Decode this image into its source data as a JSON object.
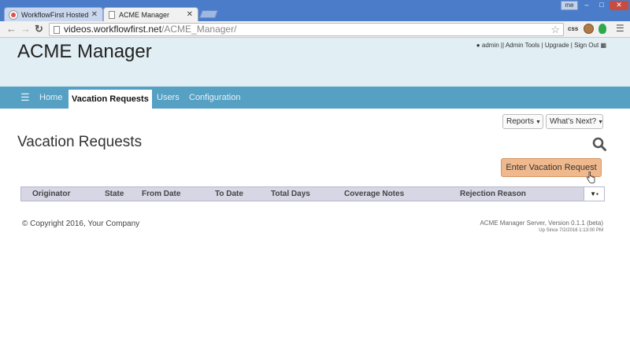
{
  "browser": {
    "tabs": [
      {
        "title": "WorkflowFirst Hosted De",
        "close": "✕"
      },
      {
        "title": "ACME Manager",
        "close": "✕"
      }
    ],
    "window_user": "me",
    "address": {
      "host": "videos.workflowfirst.net",
      "path": "/ACME_Manager/"
    },
    "extensions": {
      "css_label": "css"
    }
  },
  "header": {
    "app_title": "ACME Manager",
    "links": {
      "admin": "admin",
      "admin_tools": "Admin Tools",
      "upgrade": "Upgrade",
      "sign_out": "Sign Out",
      "separator": "|"
    }
  },
  "navbar": {
    "items": [
      {
        "label": "Home"
      },
      {
        "label": "Vacation Requests"
      },
      {
        "label": "Users"
      },
      {
        "label": "Configuration"
      }
    ]
  },
  "toolbar": {
    "reports_label": "Reports",
    "whats_next_label": "What's Next?"
  },
  "page": {
    "heading": "Vacation Requests",
    "enter_button": "Enter Vacation Request"
  },
  "grid": {
    "columns": [
      "Originator",
      "State",
      "From Date",
      "To Date",
      "Total Days",
      "Coverage Notes",
      "Rejection Reason"
    ],
    "menu_label": "▼▪"
  },
  "footer": {
    "copyright": "© Copyright 2016, Your Company",
    "server_version": "ACME Manager Server, Version 0.1.1 (beta)",
    "uptime": "Up Since 7/2/2016 1:13:00 PM"
  },
  "colors": {
    "chrome_blue": "#4a7cc9",
    "header_bg": "#e1eef3",
    "navbar_bg": "#55a0c3",
    "enter_button_bg": "#f0b98d",
    "grid_header_bg": "#d6d6e4"
  }
}
